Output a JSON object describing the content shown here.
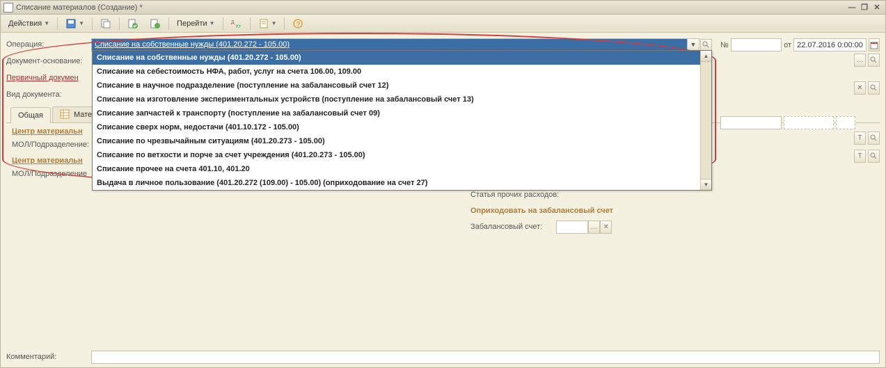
{
  "window": {
    "title": "Списание материалов (Создание) *"
  },
  "toolbar": {
    "actions": "Действия",
    "goto": "Перейти"
  },
  "labels": {
    "operation": "Операция:",
    "basis_doc": "Документ-основание:",
    "primary_doc": "Первичный докумен",
    "doc_type": "Вид документа:",
    "center1": "Центр материальн",
    "mol1": "МОЛ/Подразделение:",
    "center2": "Центр материальн",
    "mol2": "МОЛ/Подразделение",
    "number": "№",
    "from": "от",
    "article": "Статья прочих расходов:",
    "offbal_head": "Оприходовать на забалансовый счет",
    "offbal_acc": "Забалансовый счет:",
    "comment": "Комментарий:"
  },
  "fields": {
    "operation_value": "Списание на собственные нужды (401.20.272 - 105.00)",
    "date_value": "22.07.2016 0:00:00"
  },
  "tabs": {
    "general": "Общая",
    "materials": "Матер"
  },
  "dropdown": {
    "items": [
      "Списание на собственные нужды (401.20.272 - 105.00)",
      "Списание на себестоимость НФА, работ, услуг на счета 106.00, 109.00",
      "Списание в научное подразделение (поступление на забалансовый счет 12)",
      "Списание на изготовление экспериментальных устройств (поступление на забалансовый счет 13)",
      "Списание запчастей к транспорту (поступление на забалансовый счет 09)",
      "Списание сверх норм, недостачи (401.10.172 - 105.00)",
      "Списание по чрезвычайным ситуациям (401.20.273 - 105.00)",
      "Списание по ветхости и порче за счет учреждения (401.20.273 - 105.00)",
      "Списание прочее на счета 401.10, 401.20",
      "Выдача в личное пользование (401.20.272 (109.00) - 105.00) (оприходование на счет 27)"
    ]
  }
}
